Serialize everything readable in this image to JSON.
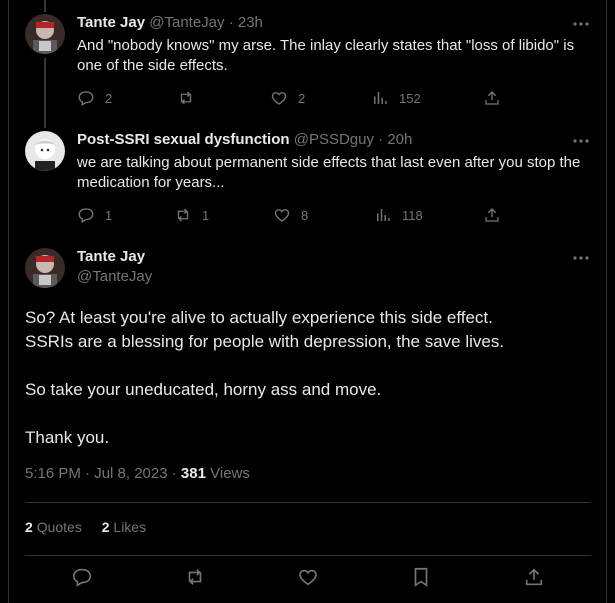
{
  "replies": [
    {
      "name": "Tante Jay",
      "handle": "@TanteJay",
      "time": "· 23h",
      "text": "And \"nobody knows\" my arse. The inlay clearly states that \"loss of libido\" is one of the side effects.",
      "reply_count": "2",
      "retweet_count": "",
      "like_count": "2",
      "view_count": "152"
    },
    {
      "name": "Post-SSRI sexual dysfunction",
      "handle": "@PSSDguy",
      "time": "· 20h",
      "text": "we are talking about permanent side effects that last even after you stop the medication for years...",
      "reply_count": "1",
      "retweet_count": "1",
      "like_count": "8",
      "view_count": "118"
    }
  ],
  "main": {
    "name": "Tante Jay",
    "handle": "@TanteJay",
    "line1": "So? At least you're alive to actually experience this side effect.",
    "line2": "SSRIs are a blessing for people with depression, the save lives.",
    "line3": "So take your uneducated, horny ass and move.",
    "line4": "Thank you.",
    "timestamp": "5:16 PM · Jul 8, 2023 ·",
    "views": "381",
    "views_label": "Views",
    "quotes_count": "2",
    "quotes_label": "Quotes",
    "likes_count": "2",
    "likes_label": "Likes"
  },
  "icons": [
    "reply-icon",
    "retweet-icon",
    "like-icon",
    "views-icon",
    "share-icon",
    "more-icon",
    "bookmark-icon"
  ]
}
